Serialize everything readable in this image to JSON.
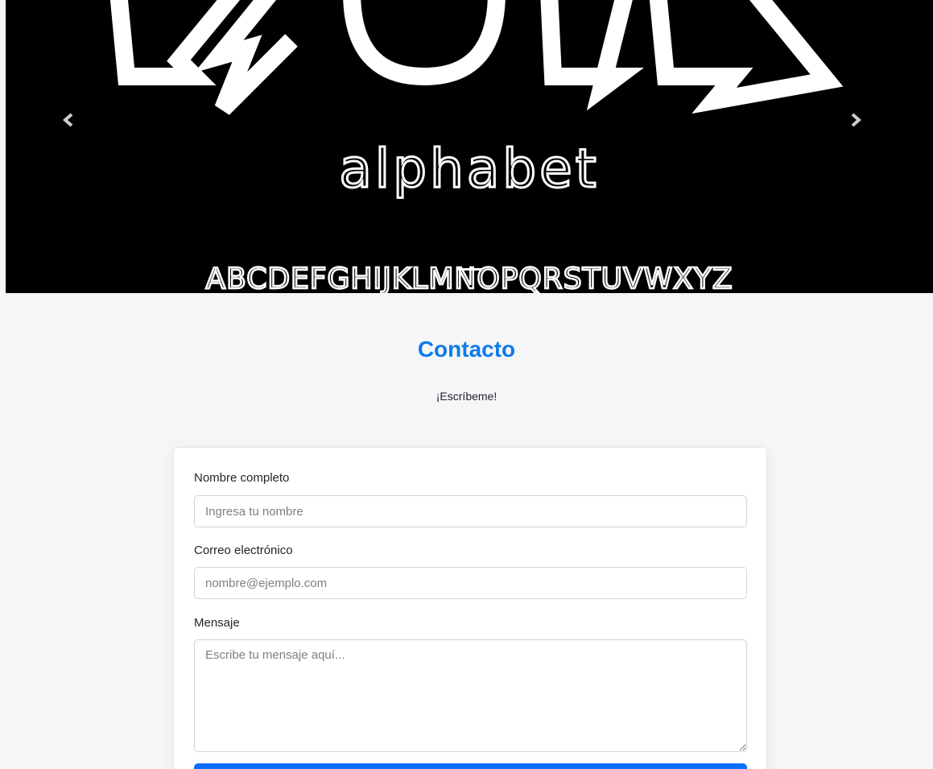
{
  "carousel": {
    "banner_word": "alphabet",
    "banner_letters": "ABCDEFGHIJKLMNOPQRSTUVWXYZ",
    "prev_label": "‹",
    "next_label": "›",
    "slide_count": 1
  },
  "contact": {
    "title": "Contacto",
    "subtitle": "¡Escríbeme!"
  },
  "form": {
    "name_label": "Nombre completo",
    "name_placeholder": "Ingresa tu nombre",
    "email_label": "Correo electrónico",
    "email_placeholder": "nombre@ejemplo.com",
    "message_label": "Mensaje",
    "message_placeholder": "Escribe tu mensaje aquí..."
  },
  "colors": {
    "accent": "#0d7bea",
    "button": "#0d6efd",
    "background": "#f5f6f8"
  }
}
